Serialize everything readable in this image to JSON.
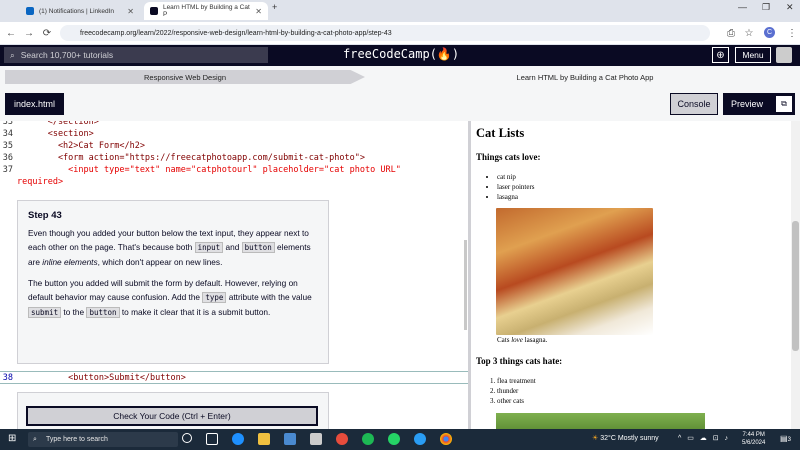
{
  "browser": {
    "tabs": [
      {
        "title": "(1) Notifications | LinkedIn",
        "active": false,
        "favicon_color": "#0a66c2"
      },
      {
        "title": "Learn HTML by Building a Cat P",
        "active": true,
        "favicon_color": "#0a0a23"
      }
    ],
    "new_tab": "+",
    "window_controls": [
      "—",
      "❐",
      "✕"
    ],
    "url": "freecodecamp.org/learn/2022/responsive-web-design/learn-html-by-building-a-cat-photo-app/step-43",
    "profile_initial": "C"
  },
  "fcc_nav": {
    "search_placeholder": "Search 10,700+ tutorials",
    "brand": "freeCodeCamp(🔥)",
    "menu_label": "Menu"
  },
  "breadcrumbs": {
    "first": "Responsive Web Design",
    "second": "Learn HTML by Building a Cat Photo App"
  },
  "toolbar": {
    "file_tab": "index.html",
    "console_label": "Console",
    "preview_label": "Preview"
  },
  "editor": {
    "lines": [
      {
        "n": "33",
        "text": "      </section>"
      },
      {
        "n": "34",
        "text": "      <section>"
      },
      {
        "n": "35",
        "text": "        <h2>Cat Form</h2>"
      },
      {
        "n": "36",
        "text": "        <form action=\"https://freecatphotoapp.com/submit-cat-photo\">"
      },
      {
        "n": "37",
        "text": "          <input type=\"text\" name=\"catphotourl\" placeholder=\"cat photo URL\""
      },
      {
        "n": "",
        "text": "required>"
      }
    ],
    "line38": {
      "n": "38",
      "text": "          <button>Submit</button>"
    }
  },
  "step": {
    "title": "Step 43",
    "p1_a": "Even though you added your button below the text input, they appear next to each other on the page. That's because both ",
    "p1_code1": "input",
    "p1_b": " and ",
    "p1_code2": "button",
    "p1_c": " elements are ",
    "p1_em": "inline elements",
    "p1_d": ", which don't appear on new lines.",
    "p2_a": "The button you added will submit the form by default. However, relying on default behavior may cause confusion. Add the ",
    "p2_code1": "type",
    "p2_b": " attribute with the value ",
    "p2_code2": "submit",
    "p2_c": " to the ",
    "p2_code3": "button",
    "p2_d": " to make it clear that it is a submit button.",
    "check_label": "Check Your Code (Ctrl + Enter)"
  },
  "preview": {
    "heading": "Cat Lists",
    "love_heading": "Things cats love:",
    "love_items": [
      "cat nip",
      "laser pointers",
      "lasagna"
    ],
    "caption_a": "Cats ",
    "caption_em": "love",
    "caption_b": " lasagna.",
    "hate_heading": "Top 3 things cats hate:",
    "hate_items": [
      "flea treatment",
      "thunder",
      "other cats"
    ]
  },
  "taskbar": {
    "search_placeholder": "Type here to search",
    "weather": "32°C  Mostly sunny",
    "time": "7:44 PM",
    "date": "5/6/2024",
    "notification_count": "3"
  }
}
